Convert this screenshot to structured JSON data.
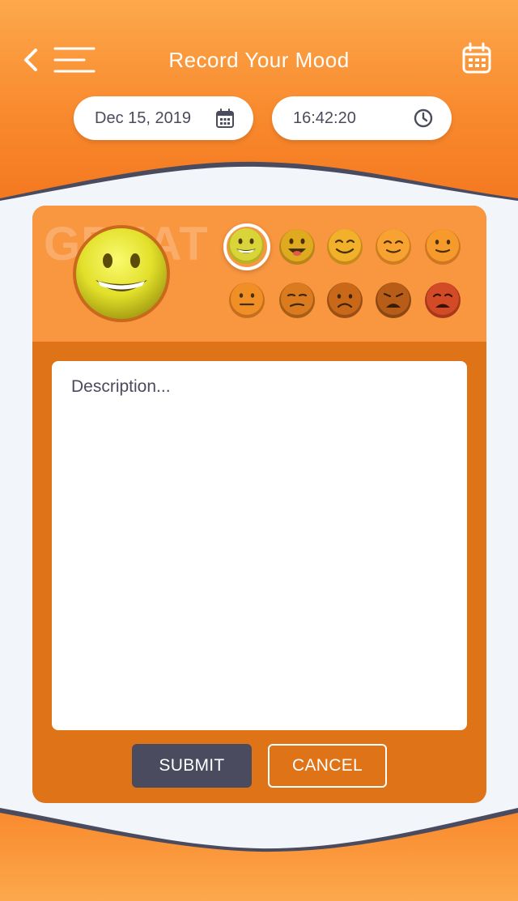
{
  "header": {
    "title": "Record Your Mood",
    "back_icon": "chevron-left-icon",
    "menu_icon": "hamburger-menu-icon",
    "calendar_icon": "calendar-icon"
  },
  "date_field": {
    "value": "Dec 15, 2019",
    "icon": "calendar-small-icon"
  },
  "time_field": {
    "value": "16:42:20",
    "icon": "clock-icon"
  },
  "mood": {
    "label": "GREAT",
    "selected_index": 0,
    "options": [
      {
        "name": "great",
        "color": "#c9c92a"
      },
      {
        "name": "very-good",
        "color": "#e0aa20"
      },
      {
        "name": "good",
        "color": "#f1b12a"
      },
      {
        "name": "happy",
        "color": "#f7a231"
      },
      {
        "name": "content",
        "color": "#f79a2c"
      },
      {
        "name": "neutral",
        "color": "#ef8f26"
      },
      {
        "name": "meh",
        "color": "#d97b1e"
      },
      {
        "name": "sad",
        "color": "#c86818"
      },
      {
        "name": "unhappy",
        "color": "#b75d18"
      },
      {
        "name": "miserable",
        "color": "#d24a26"
      }
    ]
  },
  "description": {
    "placeholder": "Description...",
    "value": ""
  },
  "actions": {
    "submit_label": "SUBMIT",
    "cancel_label": "CANCEL"
  },
  "colors": {
    "header_top": "#fda84c",
    "header_bottom": "#f47820",
    "card": "#df7318",
    "card_band": "#f99640",
    "wave_dark": "#4a4b5f",
    "background": "#f2f5f9"
  }
}
